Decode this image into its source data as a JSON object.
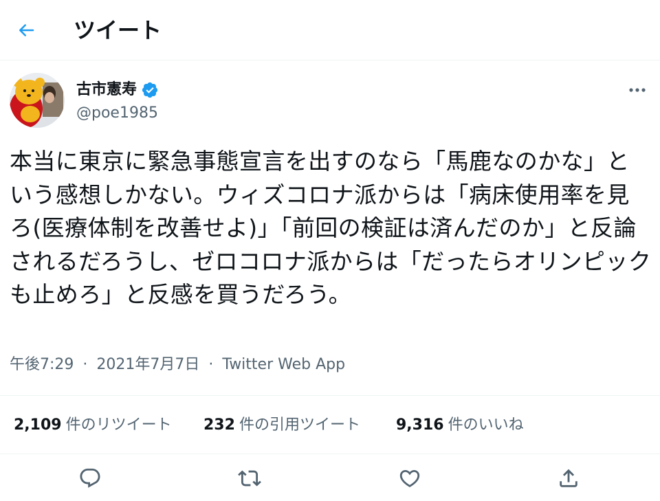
{
  "header": {
    "title": "ツイート"
  },
  "author": {
    "display_name": "古市憲寿",
    "handle": "@poe1985",
    "verified": true
  },
  "tweet": {
    "text": "本当に東京に緊急事態宣言を出すのなら「馬鹿なのかな」という感想しかない。ウィズコロナ派からは「病床使用率を見ろ(医療体制を改善せよ)」「前回の検証は済んだのか」と反論されるだろうし、ゼロコロナ派からは「だったらオリンピックも止めろ」と反感を買うだろう。",
    "time": "午後7:29",
    "separator": "·",
    "date": "2021年7月7日",
    "source": "Twitter Web App"
  },
  "stats": {
    "retweets": {
      "count": "2,109",
      "label": "件のリツイート"
    },
    "quotes": {
      "count": "232",
      "label": "件の引用ツイート"
    },
    "likes": {
      "count": "9,316",
      "label": "件のいいね"
    }
  },
  "colors": {
    "accent": "#1d9bf0",
    "text": "#0f1419",
    "secondary": "#536471",
    "divider": "#eff3f4"
  },
  "icons": {
    "back": "arrow-left-icon",
    "verified": "verified-badge-icon",
    "more": "more-horizontal-icon",
    "reply": "reply-icon",
    "retweet": "retweet-icon",
    "like": "heart-icon",
    "share": "share-icon"
  }
}
